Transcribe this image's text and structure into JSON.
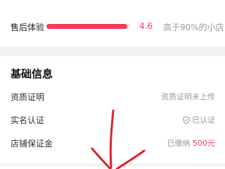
{
  "score": {
    "label": "售后体验",
    "value": "4.6",
    "fill_fraction": 0.96,
    "compare": "高于90%的小店"
  },
  "basic_info": {
    "title": "基础信息",
    "rows": [
      {
        "label": "资质证明",
        "value": "资质证明未上传"
      },
      {
        "label": "实名认证",
        "value": "已认证",
        "icon": "shield-check-icon"
      },
      {
        "label": "店铺保证金",
        "value_prefix": "已缴纳",
        "value_amount": "500元"
      }
    ]
  },
  "colors": {
    "accent": "#f23c5e",
    "muted_text": "#9a9a9a",
    "background": "#f3f3f3",
    "annotation_arrow": "#d9262e"
  }
}
